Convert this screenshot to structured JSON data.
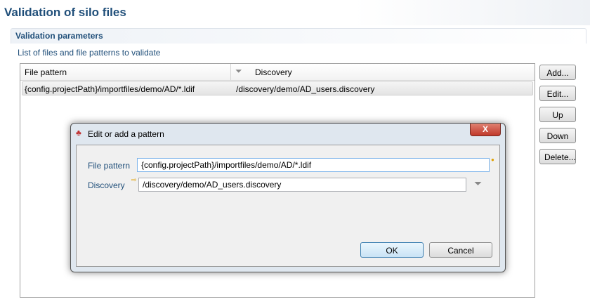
{
  "page": {
    "title": "Validation of silo files",
    "section": "Validation parameters",
    "list_label": "List of files and file patterns to validate"
  },
  "table": {
    "columns": [
      "File pattern",
      "Discovery"
    ],
    "rows": [
      {
        "pattern": "{config.projectPath}/importfiles/demo/AD/*.ldif",
        "discovery": "/discovery/demo/AD_users.discovery"
      }
    ]
  },
  "buttons": {
    "add": "Add...",
    "edit": "Edit...",
    "up": "Up",
    "down": "Down",
    "delete": "Delete..."
  },
  "dialog": {
    "title": "Edit or add a pattern",
    "close": "X",
    "file_pattern_label": "File pattern",
    "file_pattern_value": "{config.projectPath}/importfiles/demo/AD/*.ldif",
    "discovery_label": "Discovery",
    "discovery_value": "/discovery/demo/AD_users.discovery",
    "ok": "OK",
    "cancel": "Cancel"
  }
}
